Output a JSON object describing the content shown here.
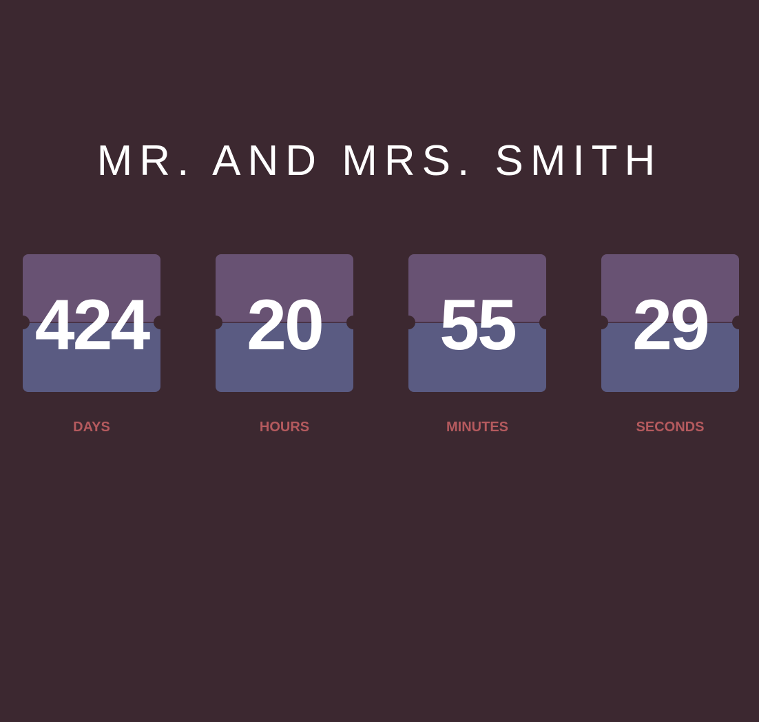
{
  "title": "MR. AND MRS. SMITH",
  "countdown": [
    {
      "value": "424",
      "label": "DAYS"
    },
    {
      "value": "20",
      "label": "HOURS"
    },
    {
      "value": "55",
      "label": "MINUTES"
    },
    {
      "value": "29",
      "label": "SECONDS"
    }
  ],
  "colors": {
    "background": "#3c2830",
    "card_top": "#685273",
    "card_bottom": "#5a5b82",
    "label": "#b55a5e",
    "digits": "#ffffff"
  }
}
